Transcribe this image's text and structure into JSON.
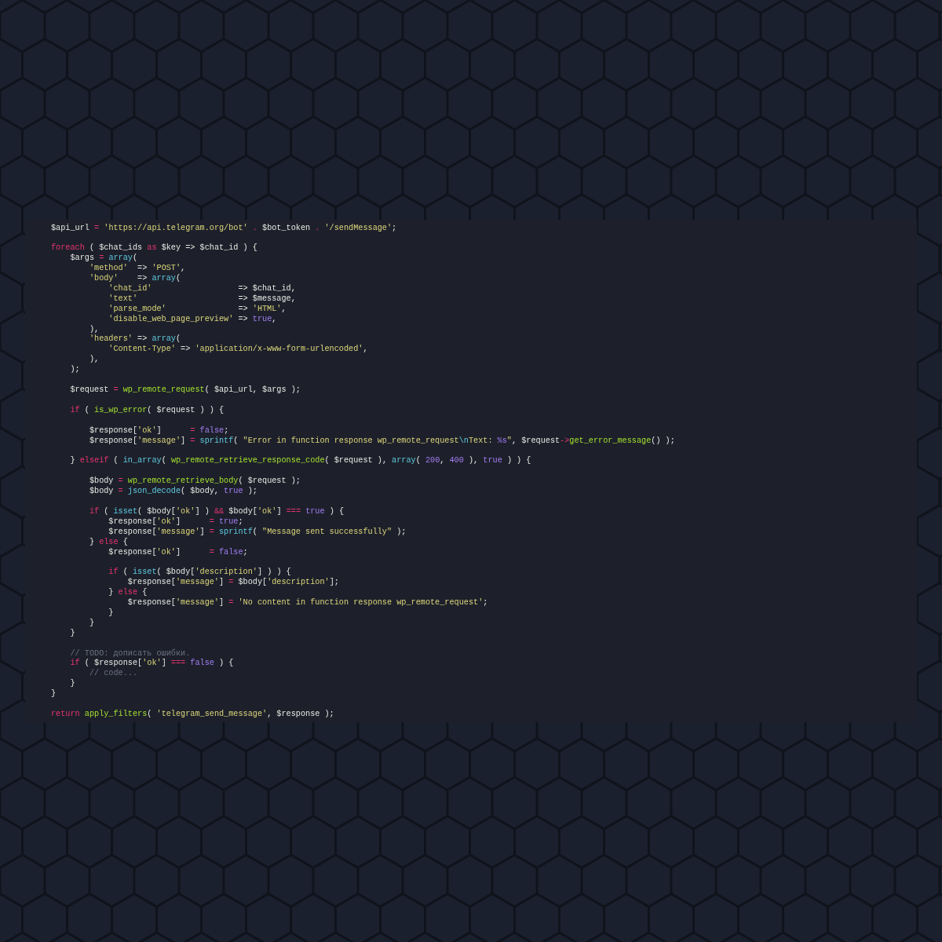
{
  "editor": {
    "lines": [
      {
        "kind": "code",
        "tokens": [
          {
            "kind": "plain",
            "text": "$api_url "
          },
          {
            "kind": "operator",
            "text": "= "
          },
          {
            "kind": "string",
            "text": "'https://api.telegram.org/bot'"
          },
          {
            "kind": "operator",
            "text": " . "
          },
          {
            "kind": "plain",
            "text": "$bot_token"
          },
          {
            "kind": "operator",
            "text": " . "
          },
          {
            "kind": "string",
            "text": "'/sendMessage'"
          },
          {
            "kind": "plain",
            "text": ";"
          }
        ]
      },
      {
        "kind": "blank"
      },
      {
        "kind": "code",
        "tokens": [
          {
            "kind": "keyword",
            "text": "foreach"
          },
          {
            "kind": "plain",
            "text": " ( $chat_ids "
          },
          {
            "kind": "keyword",
            "text": "as"
          },
          {
            "kind": "plain",
            "text": " $key => $chat_id ) {"
          }
        ]
      },
      {
        "kind": "code",
        "tokens": [
          {
            "kind": "plain",
            "text": "    $args "
          },
          {
            "kind": "operator",
            "text": "= "
          },
          {
            "kind": "builtin",
            "text": "array"
          },
          {
            "kind": "plain",
            "text": "("
          }
        ]
      },
      {
        "kind": "code",
        "tokens": [
          {
            "kind": "string",
            "text": "        'method'"
          },
          {
            "kind": "plain",
            "text": "  => "
          },
          {
            "kind": "string",
            "text": "'POST'"
          },
          {
            "kind": "plain",
            "text": ","
          }
        ]
      },
      {
        "kind": "code",
        "tokens": [
          {
            "kind": "string",
            "text": "        'body'"
          },
          {
            "kind": "plain",
            "text": "    => "
          },
          {
            "kind": "builtin",
            "text": "array"
          },
          {
            "kind": "plain",
            "text": "("
          }
        ]
      },
      {
        "kind": "code",
        "tokens": [
          {
            "kind": "string",
            "text": "            'chat_id'"
          },
          {
            "kind": "plain",
            "text": "                  => $chat_id,"
          }
        ]
      },
      {
        "kind": "code",
        "tokens": [
          {
            "kind": "string",
            "text": "            'text'"
          },
          {
            "kind": "plain",
            "text": "                     => $message,"
          }
        ]
      },
      {
        "kind": "code",
        "tokens": [
          {
            "kind": "string",
            "text": "            'parse_mode'"
          },
          {
            "kind": "plain",
            "text": "               => "
          },
          {
            "kind": "string",
            "text": "'HTML'"
          },
          {
            "kind": "plain",
            "text": ","
          }
        ]
      },
      {
        "kind": "code",
        "tokens": [
          {
            "kind": "string",
            "text": "            'disable_web_page_preview'"
          },
          {
            "kind": "plain",
            "text": " => "
          },
          {
            "kind": "constant",
            "text": "true"
          },
          {
            "kind": "plain",
            "text": ","
          }
        ]
      },
      {
        "kind": "code",
        "tokens": [
          {
            "kind": "plain",
            "text": "        ),"
          }
        ]
      },
      {
        "kind": "code",
        "tokens": [
          {
            "kind": "string",
            "text": "        'headers'"
          },
          {
            "kind": "plain",
            "text": " => "
          },
          {
            "kind": "builtin",
            "text": "array"
          },
          {
            "kind": "plain",
            "text": "("
          }
        ]
      },
      {
        "kind": "code",
        "tokens": [
          {
            "kind": "string",
            "text": "            'Content-Type'"
          },
          {
            "kind": "plain",
            "text": " => "
          },
          {
            "kind": "string",
            "text": "'application/x-www-form-urlencoded'"
          },
          {
            "kind": "plain",
            "text": ","
          }
        ]
      },
      {
        "kind": "code",
        "tokens": [
          {
            "kind": "plain",
            "text": "        ),"
          }
        ]
      },
      {
        "kind": "code",
        "tokens": [
          {
            "kind": "plain",
            "text": "    );"
          }
        ]
      },
      {
        "kind": "blank"
      },
      {
        "kind": "code",
        "tokens": [
          {
            "kind": "plain",
            "text": "    $request "
          },
          {
            "kind": "operator",
            "text": "= "
          },
          {
            "kind": "function",
            "text": "wp_remote_request"
          },
          {
            "kind": "plain",
            "text": "( $api_url, $args );"
          }
        ]
      },
      {
        "kind": "blank"
      },
      {
        "kind": "code",
        "tokens": [
          {
            "kind": "keyword",
            "text": "    if"
          },
          {
            "kind": "plain",
            "text": " ( "
          },
          {
            "kind": "function",
            "text": "is_wp_error"
          },
          {
            "kind": "plain",
            "text": "( $request ) ) {"
          }
        ]
      },
      {
        "kind": "blank"
      },
      {
        "kind": "code",
        "tokens": [
          {
            "kind": "plain",
            "text": "        $response["
          },
          {
            "kind": "string",
            "text": "'ok'"
          },
          {
            "kind": "plain",
            "text": "]      "
          },
          {
            "kind": "operator",
            "text": "= "
          },
          {
            "kind": "constant",
            "text": "false"
          },
          {
            "kind": "plain",
            "text": ";"
          }
        ]
      },
      {
        "kind": "code",
        "tokens": [
          {
            "kind": "plain",
            "text": "        $response["
          },
          {
            "kind": "string",
            "text": "'message'"
          },
          {
            "kind": "plain",
            "text": "] "
          },
          {
            "kind": "operator",
            "text": "= "
          },
          {
            "kind": "builtin",
            "text": "sprintf"
          },
          {
            "kind": "plain",
            "text": "( "
          },
          {
            "kind": "string",
            "text": "\"Error in function response wp_remote_request"
          },
          {
            "kind": "escape",
            "text": "\\n"
          },
          {
            "kind": "string",
            "text": "Text: "
          },
          {
            "kind": "constant",
            "text": "%s"
          },
          {
            "kind": "string",
            "text": "\""
          },
          {
            "kind": "plain",
            "text": ", $request"
          },
          {
            "kind": "operator",
            "text": "->"
          },
          {
            "kind": "function",
            "text": "get_error_message"
          },
          {
            "kind": "plain",
            "text": "() );"
          }
        ]
      },
      {
        "kind": "blank"
      },
      {
        "kind": "code",
        "tokens": [
          {
            "kind": "plain",
            "text": "    } "
          },
          {
            "kind": "keyword",
            "text": "elseif"
          },
          {
            "kind": "plain",
            "text": " ( "
          },
          {
            "kind": "builtin",
            "text": "in_array"
          },
          {
            "kind": "plain",
            "text": "( "
          },
          {
            "kind": "function",
            "text": "wp_remote_retrieve_response_code"
          },
          {
            "kind": "plain",
            "text": "( $request ), "
          },
          {
            "kind": "builtin",
            "text": "array"
          },
          {
            "kind": "plain",
            "text": "( "
          },
          {
            "kind": "constant",
            "text": "200"
          },
          {
            "kind": "plain",
            "text": ", "
          },
          {
            "kind": "constant",
            "text": "400"
          },
          {
            "kind": "plain",
            "text": " ), "
          },
          {
            "kind": "constant",
            "text": "true"
          },
          {
            "kind": "plain",
            "text": " ) ) {"
          }
        ]
      },
      {
        "kind": "blank"
      },
      {
        "kind": "code",
        "tokens": [
          {
            "kind": "plain",
            "text": "        $body "
          },
          {
            "kind": "operator",
            "text": "= "
          },
          {
            "kind": "function",
            "text": "wp_remote_retrieve_body"
          },
          {
            "kind": "plain",
            "text": "( $request );"
          }
        ]
      },
      {
        "kind": "code",
        "tokens": [
          {
            "kind": "plain",
            "text": "        $body "
          },
          {
            "kind": "operator",
            "text": "= "
          },
          {
            "kind": "builtin",
            "text": "json_decode"
          },
          {
            "kind": "plain",
            "text": "( $body, "
          },
          {
            "kind": "constant",
            "text": "true"
          },
          {
            "kind": "plain",
            "text": " );"
          }
        ]
      },
      {
        "kind": "blank"
      },
      {
        "kind": "code",
        "tokens": [
          {
            "kind": "keyword",
            "text": "        if"
          },
          {
            "kind": "plain",
            "text": " ( "
          },
          {
            "kind": "builtin",
            "text": "isset"
          },
          {
            "kind": "plain",
            "text": "( $body["
          },
          {
            "kind": "string",
            "text": "'ok'"
          },
          {
            "kind": "plain",
            "text": "] ) "
          },
          {
            "kind": "operator",
            "text": "&&"
          },
          {
            "kind": "plain",
            "text": " $body["
          },
          {
            "kind": "string",
            "text": "'ok'"
          },
          {
            "kind": "plain",
            "text": "] "
          },
          {
            "kind": "operator",
            "text": "=== "
          },
          {
            "kind": "constant",
            "text": "true"
          },
          {
            "kind": "plain",
            "text": " ) {"
          }
        ]
      },
      {
        "kind": "code",
        "tokens": [
          {
            "kind": "plain",
            "text": "            $response["
          },
          {
            "kind": "string",
            "text": "'ok'"
          },
          {
            "kind": "plain",
            "text": "]      "
          },
          {
            "kind": "operator",
            "text": "= "
          },
          {
            "kind": "constant",
            "text": "true"
          },
          {
            "kind": "plain",
            "text": ";"
          }
        ]
      },
      {
        "kind": "code",
        "tokens": [
          {
            "kind": "plain",
            "text": "            $response["
          },
          {
            "kind": "string",
            "text": "'message'"
          },
          {
            "kind": "plain",
            "text": "] "
          },
          {
            "kind": "operator",
            "text": "= "
          },
          {
            "kind": "builtin",
            "text": "sprintf"
          },
          {
            "kind": "plain",
            "text": "( "
          },
          {
            "kind": "string",
            "text": "\"Message sent successfully\""
          },
          {
            "kind": "plain",
            "text": " );"
          }
        ]
      },
      {
        "kind": "code",
        "tokens": [
          {
            "kind": "plain",
            "text": "        } "
          },
          {
            "kind": "keyword",
            "text": "else"
          },
          {
            "kind": "plain",
            "text": " {"
          }
        ]
      },
      {
        "kind": "code",
        "tokens": [
          {
            "kind": "plain",
            "text": "            $response["
          },
          {
            "kind": "string",
            "text": "'ok'"
          },
          {
            "kind": "plain",
            "text": "]      "
          },
          {
            "kind": "operator",
            "text": "= "
          },
          {
            "kind": "constant",
            "text": "false"
          },
          {
            "kind": "plain",
            "text": ";"
          }
        ]
      },
      {
        "kind": "blank"
      },
      {
        "kind": "code",
        "tokens": [
          {
            "kind": "keyword",
            "text": "            if"
          },
          {
            "kind": "plain",
            "text": " ( "
          },
          {
            "kind": "builtin",
            "text": "isset"
          },
          {
            "kind": "plain",
            "text": "( $body["
          },
          {
            "kind": "string",
            "text": "'description'"
          },
          {
            "kind": "plain",
            "text": "] ) ) {"
          }
        ]
      },
      {
        "kind": "code",
        "tokens": [
          {
            "kind": "plain",
            "text": "                $response["
          },
          {
            "kind": "string",
            "text": "'message'"
          },
          {
            "kind": "plain",
            "text": "] "
          },
          {
            "kind": "operator",
            "text": "="
          },
          {
            "kind": "plain",
            "text": " $body["
          },
          {
            "kind": "string",
            "text": "'description'"
          },
          {
            "kind": "plain",
            "text": "];"
          }
        ]
      },
      {
        "kind": "code",
        "tokens": [
          {
            "kind": "plain",
            "text": "            } "
          },
          {
            "kind": "keyword",
            "text": "else"
          },
          {
            "kind": "plain",
            "text": " {"
          }
        ]
      },
      {
        "kind": "code",
        "tokens": [
          {
            "kind": "plain",
            "text": "                $response["
          },
          {
            "kind": "string",
            "text": "'message'"
          },
          {
            "kind": "plain",
            "text": "] "
          },
          {
            "kind": "operator",
            "text": "= "
          },
          {
            "kind": "string",
            "text": "'No content in function response wp_remote_request'"
          },
          {
            "kind": "plain",
            "text": ";"
          }
        ]
      },
      {
        "kind": "code",
        "tokens": [
          {
            "kind": "plain",
            "text": "            }"
          }
        ]
      },
      {
        "kind": "code",
        "tokens": [
          {
            "kind": "plain",
            "text": "        }"
          }
        ]
      },
      {
        "kind": "code",
        "tokens": [
          {
            "kind": "plain",
            "text": "    }"
          }
        ]
      },
      {
        "kind": "blank"
      },
      {
        "kind": "code",
        "tokens": [
          {
            "kind": "comment",
            "text": "    // TODO: дописать ошибки."
          }
        ]
      },
      {
        "kind": "code",
        "tokens": [
          {
            "kind": "keyword",
            "text": "    if"
          },
          {
            "kind": "plain",
            "text": " ( $response["
          },
          {
            "kind": "string",
            "text": "'ok'"
          },
          {
            "kind": "plain",
            "text": "] "
          },
          {
            "kind": "operator",
            "text": "=== "
          },
          {
            "kind": "constant",
            "text": "false"
          },
          {
            "kind": "plain",
            "text": " ) {"
          }
        ]
      },
      {
        "kind": "code",
        "tokens": [
          {
            "kind": "comment",
            "text": "        // code..."
          }
        ]
      },
      {
        "kind": "code",
        "tokens": [
          {
            "kind": "plain",
            "text": "    }"
          }
        ]
      },
      {
        "kind": "code",
        "tokens": [
          {
            "kind": "plain",
            "text": "}"
          }
        ]
      },
      {
        "kind": "blank"
      },
      {
        "kind": "code",
        "tokens": [
          {
            "kind": "keyword",
            "text": "return "
          },
          {
            "kind": "function",
            "text": "apply_filters"
          },
          {
            "kind": "plain",
            "text": "( "
          },
          {
            "kind": "string",
            "text": "'telegram_send_message'"
          },
          {
            "kind": "plain",
            "text": ", $response );"
          }
        ]
      }
    ]
  }
}
